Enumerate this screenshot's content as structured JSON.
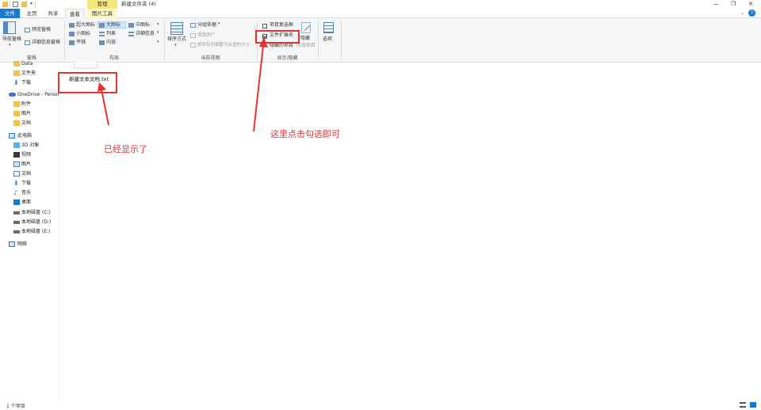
{
  "titlebar": {
    "context_tab": "管理",
    "title": "新建文件夹 (4)",
    "minimize": "—",
    "restore": "❐",
    "close": "✕"
  },
  "tabs": {
    "file": "文件",
    "home": "主页",
    "share": "共享",
    "view": "查看",
    "picture_tools": "图片工具"
  },
  "ribbon": {
    "nav_pane": "导航窗格",
    "preview_pane": "预览窗格",
    "details_pane": "详细信息窗格",
    "pane_group": "窗格",
    "layout": {
      "extra_large": "超大图标",
      "large": "大图标",
      "medium": "中图标",
      "small": "小图标",
      "list": "列表",
      "details": "详细信息",
      "tiles": "平铺",
      "content": "内容",
      "group": "布局"
    },
    "sort_by": "排序方式",
    "group_by": "分组依据",
    "add_columns": "添加列",
    "size_columns": "将所有列调整为合适的大小",
    "current_view_group": "当前视图",
    "item_checkboxes": "项目复选框",
    "file_extensions": "文件扩展名",
    "hidden_items": "隐藏的项目",
    "hide_selected": "隐藏",
    "hide_selected_sub": "所选项目",
    "show_hide_group": "显示/隐藏",
    "options": "选项",
    "file_extensions_checked": true,
    "item_checkboxes_checked": false
  },
  "nav": {
    "items": [
      {
        "label": "Data",
        "icon": "folder-icon"
      },
      {
        "label": "文件夹",
        "icon": "folder-icon"
      },
      {
        "label": "下载",
        "icon": "download-icon"
      },
      {
        "label": "OneDrive - Personal",
        "icon": "cloud-icon"
      },
      {
        "label": "附件",
        "icon": "folder-icon"
      },
      {
        "label": "图片",
        "icon": "folder-icon"
      },
      {
        "label": "文档",
        "icon": "folder-icon"
      },
      {
        "label": "此电脑",
        "icon": "computer-icon"
      },
      {
        "label": "3D 对象",
        "icon": "cube-icon"
      },
      {
        "label": "视频",
        "icon": "video-icon"
      },
      {
        "label": "图片",
        "icon": "picture-icon"
      },
      {
        "label": "文档",
        "icon": "document-icon"
      },
      {
        "label": "下载",
        "icon": "download-icon"
      },
      {
        "label": "音乐",
        "icon": "music-icon"
      },
      {
        "label": "桌面",
        "icon": "desktop-icon"
      },
      {
        "label": "本地磁盘 (C:)",
        "icon": "drive-icon"
      },
      {
        "label": "本地磁盘 (D:)",
        "icon": "drive-icon"
      },
      {
        "label": "本地磁盘 (E:)",
        "icon": "drive-icon"
      },
      {
        "label": "网络",
        "icon": "network-icon"
      }
    ]
  },
  "content": {
    "file_name": "新建文本文档.txt"
  },
  "status": {
    "item_count": "1 个项目"
  },
  "annotations": {
    "shown_text": "已经显示了",
    "click_text": "这里点击勾选即可"
  },
  "colors": {
    "accent": "#1979ca",
    "annotation": "#e53333",
    "context_tab": "#f5e77c",
    "folder": "#f0c14b"
  }
}
